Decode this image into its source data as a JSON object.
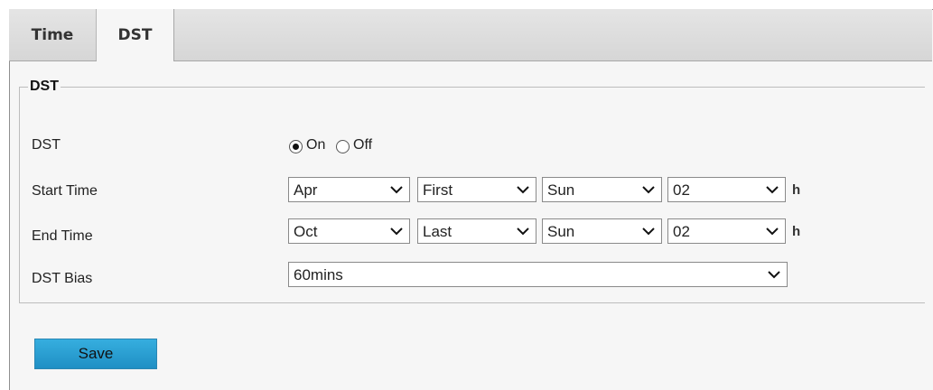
{
  "tabs": [
    {
      "label": "Time"
    },
    {
      "label": "DST"
    }
  ],
  "group": {
    "legend": "DST"
  },
  "dst": {
    "label": "DST",
    "on_label": "On",
    "off_label": "Off",
    "selected": "On"
  },
  "start_time": {
    "label": "Start Time",
    "month": "Apr",
    "week": "First",
    "day": "Sun",
    "hour": "02",
    "unit": "h"
  },
  "end_time": {
    "label": "End Time",
    "month": "Oct",
    "week": "Last",
    "day": "Sun",
    "hour": "02",
    "unit": "h"
  },
  "dst_bias": {
    "label": "DST Bias",
    "value": "60mins"
  },
  "save_button": {
    "label": "Save"
  },
  "colors": {
    "accent": "#1f8fc4",
    "panel": "#f6f6f6",
    "tabbar": "#dcdcdc"
  }
}
